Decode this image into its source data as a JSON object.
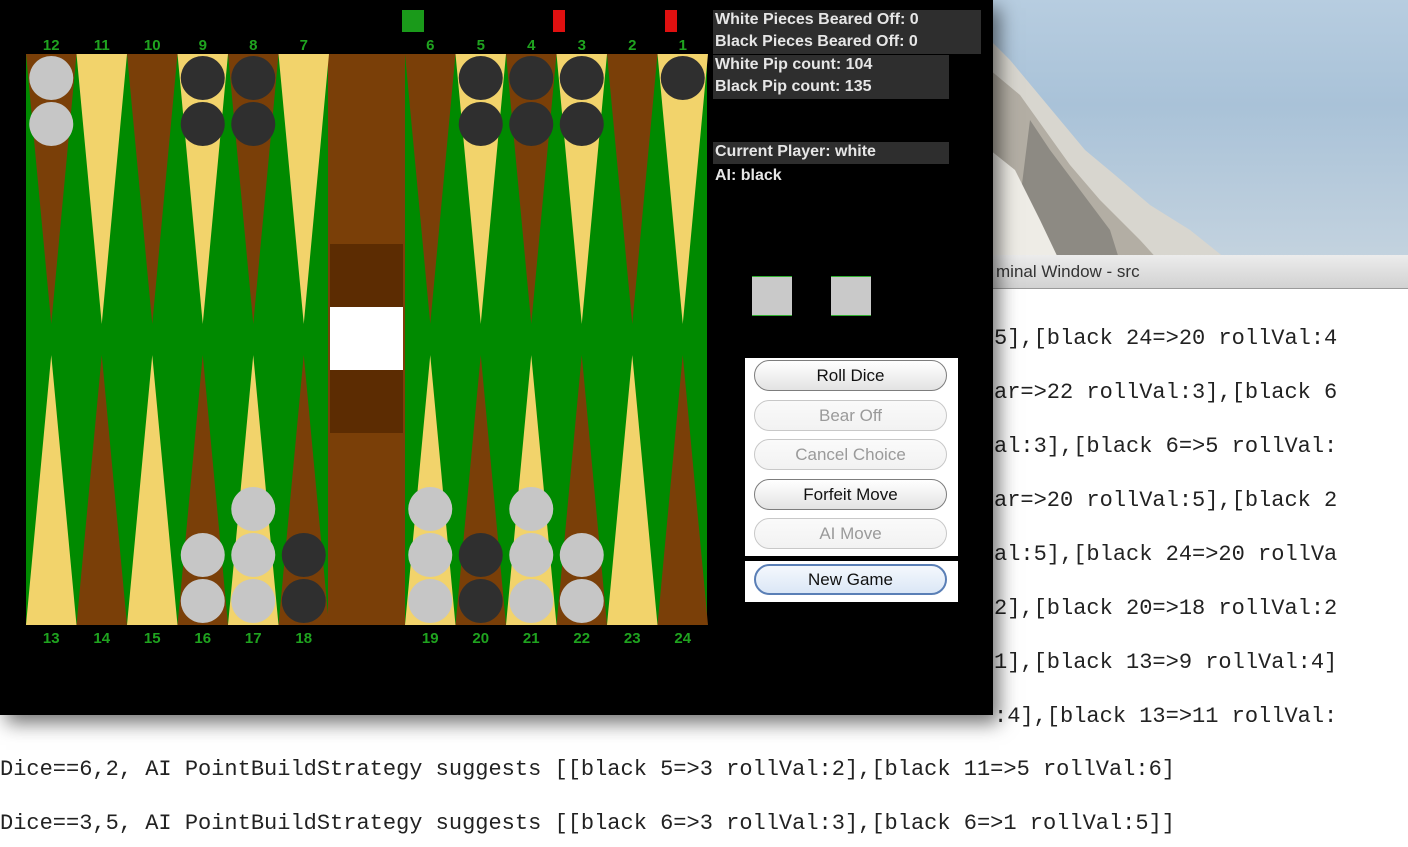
{
  "terminal": {
    "title": "minal Window - src",
    "lines": [
      "5],[black 24=>20 rollVal:4",
      "ar=>22 rollVal:3],[black 6",
      "al:3],[black 6=>5 rollVal:",
      "ar=>20 rollVal:5],[black 2",
      "al:5],[black 24=>20 rollVa",
      "2],[black 20=>18 rollVal:2",
      "1],[black 13=>9 rollVal:4]",
      ":4],[black 13=>11 rollVal:",
      "Dice==6,2, AI PointBuildStrategy suggests [[black 5=>3 rollVal:2],[black 11=>5 rollVal:6]",
      "Dice==3,5, AI PointBuildStrategy suggests [[black 6=>3 rollVal:3],[black 6=>1 rollVal:5]]"
    ]
  },
  "board": {
    "top_points": [
      "12",
      "11",
      "10",
      "9",
      "8",
      "7",
      "6",
      "5",
      "4",
      "3",
      "2",
      "1"
    ],
    "bottom_points": [
      "13",
      "14",
      "15",
      "16",
      "17",
      "18",
      "19",
      "20",
      "21",
      "22",
      "23",
      "24"
    ],
    "colors": {
      "felt": "#008a00",
      "brown": "#7a3f08",
      "tan": "#f2d36b",
      "bar": "#7a3f08",
      "white_checker": "#c6c6c6",
      "black_checker": "#2f2f2f",
      "point_number": "#1fa31f"
    },
    "checkers": {
      "12": {
        "color": "white",
        "count": 2
      },
      "9": {
        "color": "black",
        "count": 2
      },
      "8": {
        "color": "black",
        "count": 2
      },
      "5": {
        "color": "black",
        "count": 2
      },
      "4": {
        "color": "black",
        "count": 2
      },
      "3": {
        "color": "black",
        "count": 2
      },
      "1": {
        "color": "black",
        "count": 1
      },
      "16": {
        "color": "white",
        "count": 2
      },
      "17": {
        "color": "white",
        "count": 3
      },
      "18": {
        "color": "black",
        "count": 2
      },
      "19": {
        "color": "white",
        "count": 3
      },
      "20": {
        "color": "black",
        "count": 2
      },
      "21": {
        "color": "white",
        "count": 3
      },
      "22": {
        "color": "white",
        "count": 2
      }
    }
  },
  "info": {
    "white_off": "White Pieces Beared Off: 0",
    "black_off": "Black Pieces Beared Off: 0",
    "white_pip": "White Pip count: 104",
    "black_pip": "Black Pip count: 135",
    "current_player": "Current Player: white",
    "ai": "AI: black"
  },
  "buttons": {
    "roll_dice": "Roll Dice",
    "bear_off": "Bear Off",
    "cancel_choice": "Cancel Choice",
    "forfeit_move": "Forfeit Move",
    "ai_move": "AI Move",
    "new_game": "New Game"
  }
}
